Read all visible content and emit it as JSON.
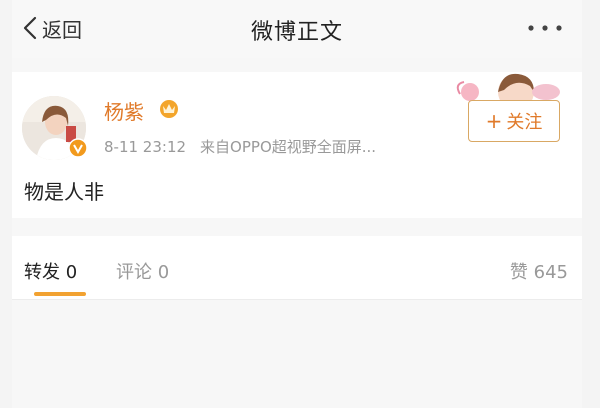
{
  "navbar": {
    "back_label": "返回",
    "title": "微博正文",
    "icons": {
      "back": "chevron-left-icon",
      "more": "more-dots-icon"
    }
  },
  "post": {
    "username": "杨紫",
    "timestamp": "8-11 23:12",
    "source": "来自OPPO超视野全面屏...",
    "text": "物是人非",
    "follow": {
      "plus": "+",
      "label": "关注"
    },
    "icons": {
      "verified": "verified-badge-icon",
      "vip": "vip-crown-icon"
    }
  },
  "tabs": {
    "repost": {
      "label": "转发",
      "count": "0"
    },
    "comment": {
      "label": "评论",
      "count": "0"
    },
    "like": {
      "label": "赞",
      "count": "645"
    }
  },
  "colors": {
    "accent": "#e07a2a",
    "underline": "#f2a231",
    "follow_border": "#d9a864",
    "muted": "#999999"
  }
}
